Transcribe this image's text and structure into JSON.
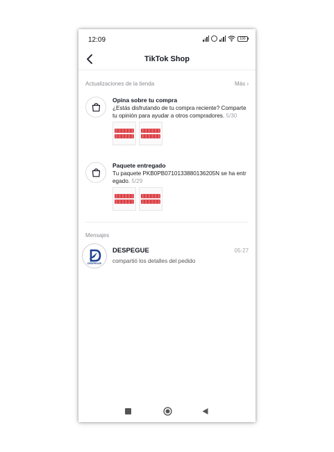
{
  "status_bar": {
    "time": "12:09",
    "battery": "100"
  },
  "header": {
    "title": "TikTok Shop",
    "back_icon": "back-chevron-icon"
  },
  "updates": {
    "label": "Actualizaciones de la tienda",
    "more": "Más",
    "items": [
      {
        "title": "Opina sobre tu compra",
        "text": "¿Estás disfrutando de tu compra reciente? Comparte tu opinión para ayudar a otros compradores.",
        "date": "5/30",
        "icon": "shopping-bag-icon"
      },
      {
        "title": "Paquete entregado",
        "text": "Tu paquete PKB0PB0710133880136205N se ha entregado.",
        "date": "5/29",
        "icon": "shopping-bag-icon"
      }
    ]
  },
  "messages": {
    "label": "Mensajes",
    "items": [
      {
        "name": "DESPEGUE",
        "preview": "compartió los detalles del pedido",
        "date": "05-27",
        "avatar_text": "DESPEGUE"
      }
    ]
  },
  "colors": {
    "product_red": "#d8282e",
    "secondary_text": "#8a8b91",
    "divider": "#ececec"
  }
}
